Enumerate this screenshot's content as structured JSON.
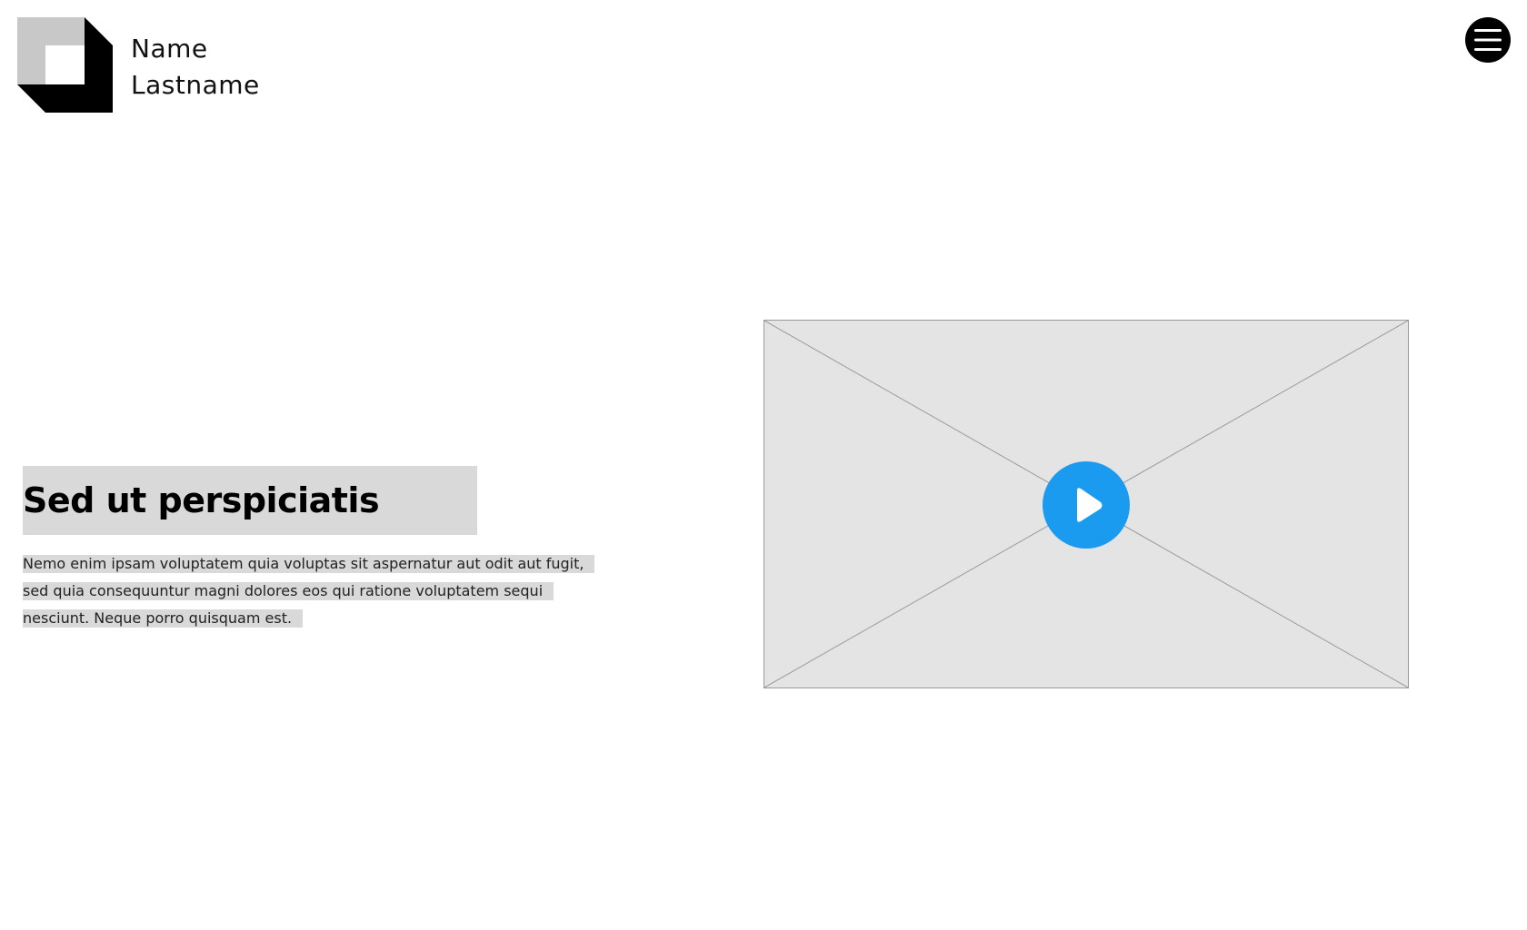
{
  "brand": {
    "first_name": "Name",
    "last_name": "Lastname",
    "logo_icon": "box-logo-icon"
  },
  "nav": {
    "menu_icon": "hamburger-menu-icon"
  },
  "hero": {
    "title": "Sed ut perspiciatis",
    "body_lines": [
      "Nemo enim ipsam voluptatem quia voluptas sit aspernatur aut odit aut fugit,",
      "sed quia consequuntur magni dolores eos qui ratione voluptatem sequi",
      "nesciunt. Neque porro quisquam est."
    ]
  },
  "video": {
    "play_icon": "play-icon",
    "accent_color": "#1a9bf0",
    "placeholder_color": "#e4e4e4"
  }
}
